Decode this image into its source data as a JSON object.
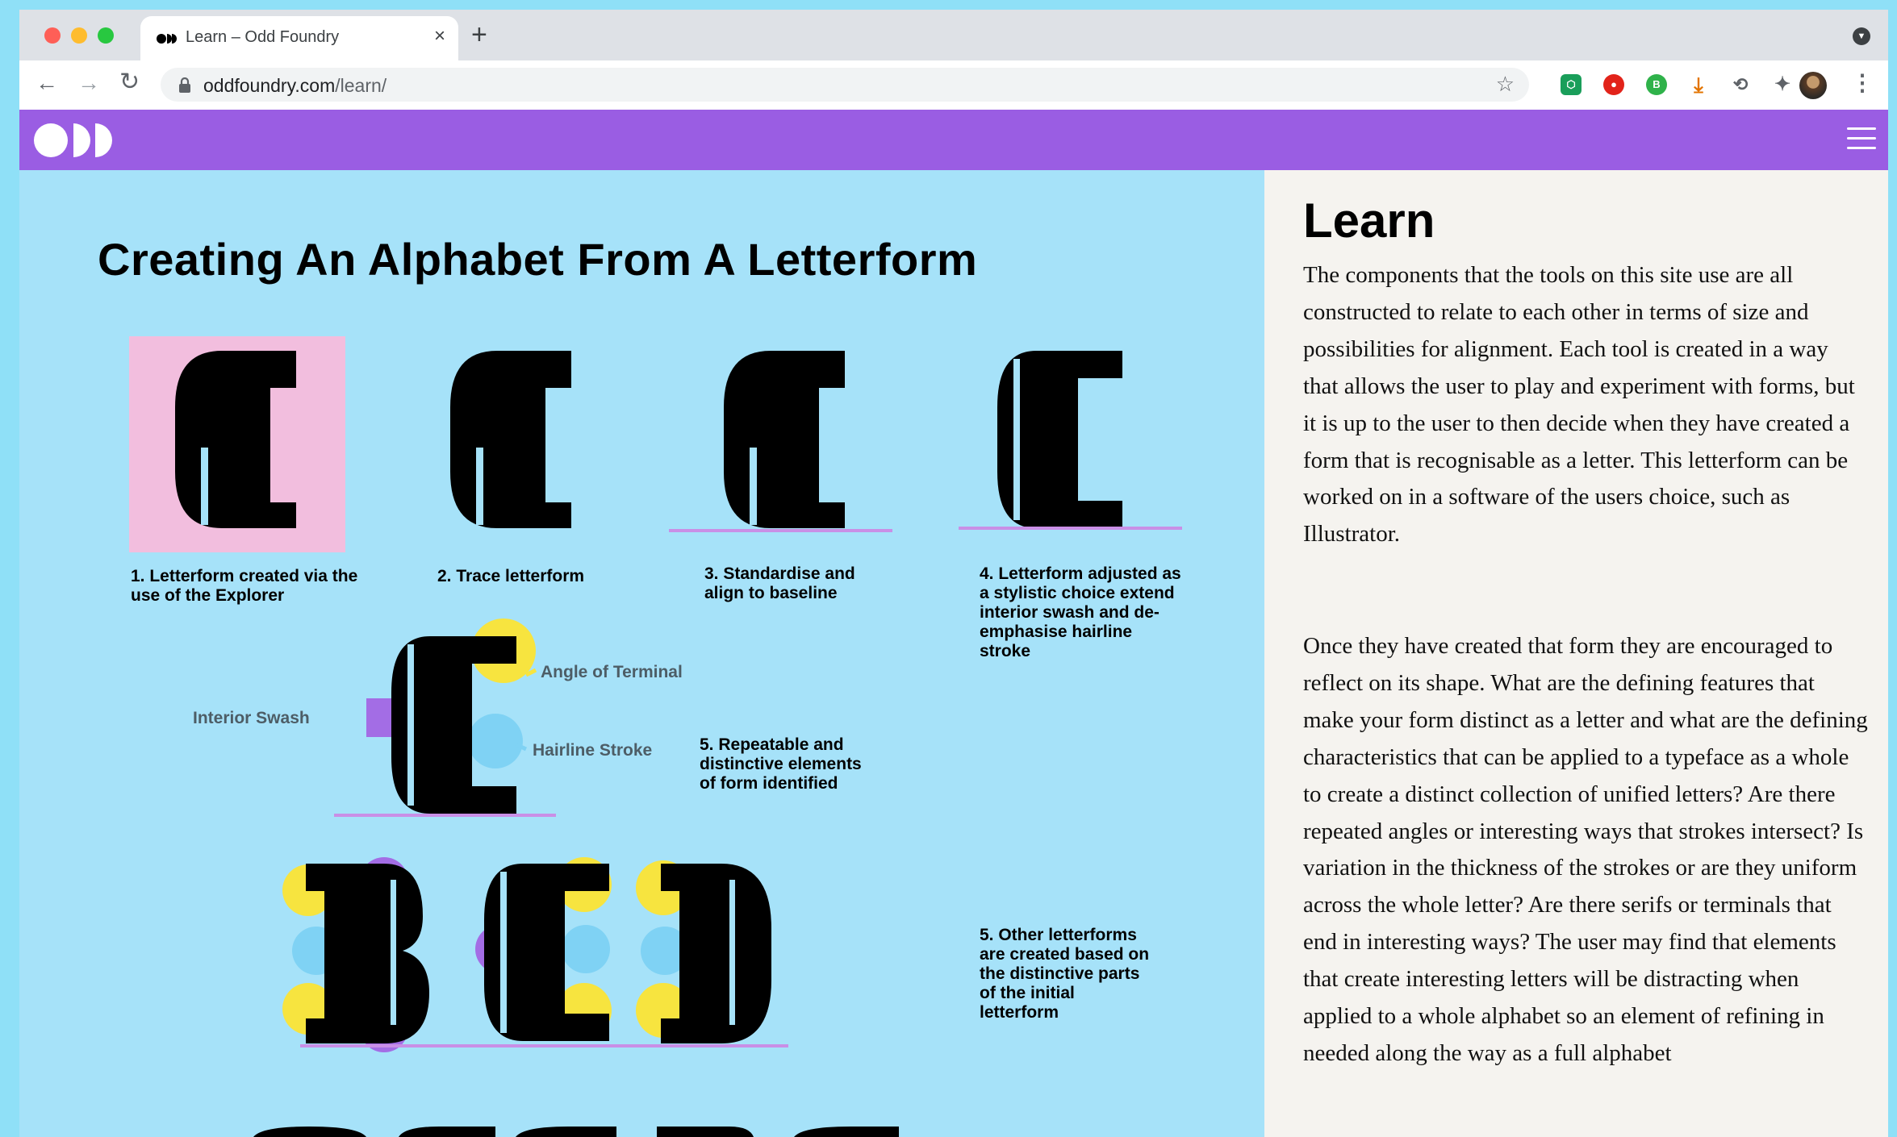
{
  "browser": {
    "tab_title": "Learn – Odd Foundry",
    "url_domain": "oddfoundry.com",
    "url_path": "/learn/",
    "traffic_colors": [
      "#fe5f57",
      "#febc2e",
      "#28c840"
    ],
    "icons": {
      "back": "arrow-left-icon",
      "forward": "arrow-right-icon",
      "reload": "reload-icon",
      "lock": "lock-icon",
      "star": "star-icon",
      "extensions": "puzzle-icon",
      "menu": "kebab-icon",
      "new_tab": "plus-icon",
      "close_tab": "close-icon"
    }
  },
  "site": {
    "brand_color": "#9a5de3",
    "panel_color": "#a6e2f9",
    "icons": {
      "logo": "odd-logo-icon",
      "menu": "hamburger-icon"
    }
  },
  "article": {
    "title": "Creating An Alphabet From A Letterform",
    "steps": {
      "s1": "1. Letterform created via the use of the Explorer",
      "s2": "2. Trace letterform",
      "s3": "3. Standardise and align to baseline",
      "s4": "4. Letterform adjusted as a stylistic choice extend interior swash and de-emphasise hairline stroke",
      "s5": "5. Repeatable and distinctive elements of form identified",
      "s6": "5. Other letterforms are created based on the distinctive parts of the initial letterform"
    },
    "annotations": {
      "angle": "Angle of Terminal",
      "swash": "Interior Swash",
      "hairline": "Hairline Stroke"
    },
    "colors": {
      "pink": "#f2bede",
      "yellow": "#f7e43f",
      "blue": "#7fd2f4",
      "purple": "#a36de5",
      "baseline": "#c98fe6"
    }
  },
  "learn": {
    "heading": "Learn",
    "para1": "The components that the tools on this site use are all constructed to relate to each other in terms of size and possibilities for alignment. Each tool is created in a way that allows the user to play and experiment with forms, but it is up to the user to then decide when they have created a form that is recognisable as a letter. This letterform can be worked on in a software of the users choice, such as Illustrator.",
    "para2": "Once they have created that form they are encouraged to reflect on its shape. What are the defining features that make your form distinct as a letter and what are the defining characteristics that can be applied to a typeface as a whole to create a distinct collection of unified letters? Are there repeated angles or interesting ways that strokes intersect? Is variation in the thickness of the strokes or are they uniform across the whole letter? Are there serifs or terminals that end in interesting ways? The user may find that elements that create interesting letters will be distracting when applied to a whole alphabet so an element of refining in needed along the way as a full alphabet"
  }
}
